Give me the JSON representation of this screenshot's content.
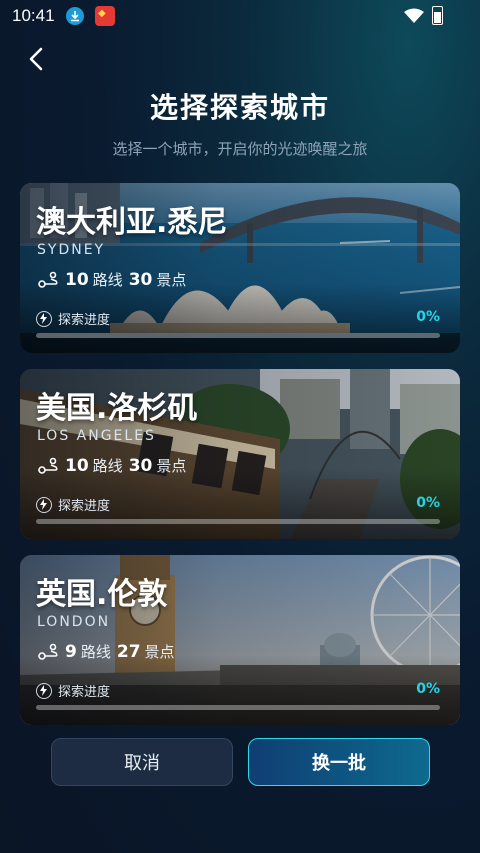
{
  "status_bar": {
    "time": "10:41"
  },
  "header": {
    "title": "选择探索城市",
    "subtitle": "选择一个城市，开启你的光迹唤醒之旅"
  },
  "cities": [
    {
      "name_cn": "澳大利亚.悉尼",
      "name_en": "SYDNEY",
      "routes": "10",
      "routes_label": "路线",
      "spots": "30",
      "spots_label": "景点",
      "progress_label": "探索进度",
      "progress_text": "0%",
      "progress": 0
    },
    {
      "name_cn": "美国.洛杉矶",
      "name_en": "LOS ANGELES",
      "routes": "10",
      "routes_label": "路线",
      "spots": "30",
      "spots_label": "景点",
      "progress_label": "探索进度",
      "progress_text": "0%",
      "progress": 0
    },
    {
      "name_cn": "英国.伦敦",
      "name_en": "LONDON",
      "routes": "9",
      "routes_label": "路线",
      "spots": "27",
      "spots_label": "景点",
      "progress_label": "探索进度",
      "progress_text": "0%",
      "progress": 0
    }
  ],
  "buttons": {
    "cancel": "取消",
    "refresh": "换一批"
  },
  "colors": {
    "accent": "#27d3e6",
    "background": "#0a1a2f"
  }
}
